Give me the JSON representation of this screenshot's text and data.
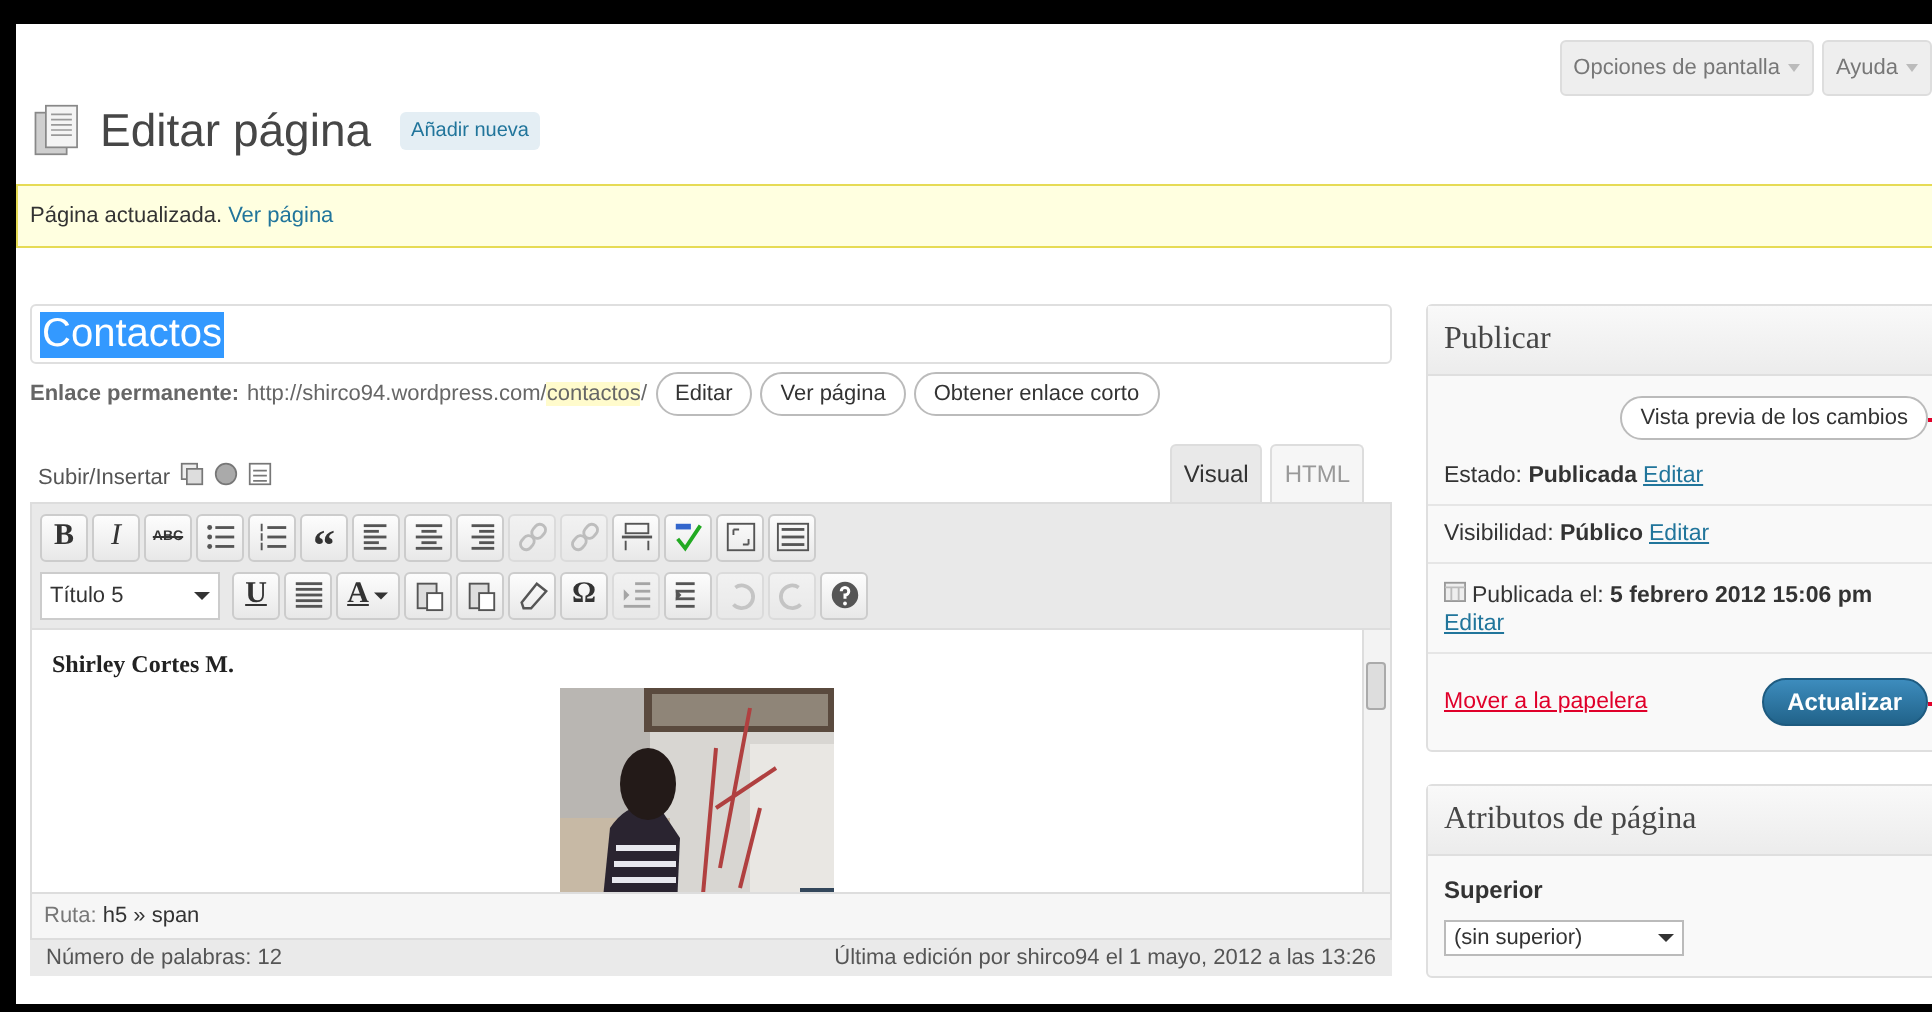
{
  "header": {
    "title": "Editar página",
    "add_new": "Añadir nueva",
    "screen_options": "Opciones de pantalla",
    "help": "Ayuda"
  },
  "notice": {
    "text": "Página actualizada.",
    "link": "Ver página"
  },
  "post_title": {
    "value": "Contactos"
  },
  "permalink": {
    "label": "Enlace permanente:",
    "url": "http://shirco94.wordpress.com/",
    "slug": "contactos",
    "suffix": "/",
    "buttons": [
      "Editar",
      "Ver página",
      "Obtener enlace corto"
    ]
  },
  "upload": {
    "label": "Subir/Insertar"
  },
  "editor_tabs": [
    {
      "label": "Visual",
      "selected": true
    },
    {
      "label": "HTML",
      "selected": false
    }
  ],
  "toolbar_row_1": [
    {
      "kind": "bold",
      "text": "B",
      "disabled": false
    },
    {
      "kind": "italic",
      "text": "I",
      "disabled": false
    },
    {
      "kind": "strike",
      "text": "ABC",
      "disabled": false
    },
    {
      "kind": "bullet-list",
      "disabled": false
    },
    {
      "kind": "number-list",
      "disabled": false
    },
    {
      "kind": "quote",
      "text": "“",
      "disabled": false
    },
    {
      "kind": "align-left",
      "disabled": false
    },
    {
      "kind": "align-center",
      "disabled": false
    },
    {
      "kind": "align-right",
      "disabled": false
    },
    {
      "kind": "link",
      "disabled": true
    },
    {
      "kind": "unlink",
      "disabled": true
    },
    {
      "kind": "more",
      "disabled": false
    },
    {
      "kind": "spellcheck",
      "disabled": false
    },
    {
      "kind": "fullscreen",
      "disabled": false
    },
    {
      "kind": "kitchen-sink",
      "disabled": false
    }
  ],
  "format_select": {
    "value": "Título 5"
  },
  "toolbar_row_2": [
    {
      "kind": "underline",
      "text": "U",
      "disabled": false
    },
    {
      "kind": "justify",
      "disabled": false
    },
    {
      "kind": "color",
      "text": "A",
      "disabled": false
    },
    {
      "kind": "paste-text",
      "disabled": false
    },
    {
      "kind": "paste-word",
      "disabled": false
    },
    {
      "kind": "eraser",
      "disabled": false
    },
    {
      "kind": "omega",
      "text": "Ω",
      "disabled": false
    },
    {
      "kind": "outdent",
      "disabled": true
    },
    {
      "kind": "indent",
      "disabled": false
    },
    {
      "kind": "undo",
      "disabled": true
    },
    {
      "kind": "redo",
      "disabled": true
    },
    {
      "kind": "help",
      "disabled": false
    }
  ],
  "content": {
    "heading": "Shirley  Cortes M."
  },
  "path": {
    "label": "Ruta:",
    "value": "h5 » span"
  },
  "status_bar": {
    "word_count": "Número de palabras: 12",
    "last_edit": "Última edición por shirco94 el 1 mayo, 2012 a las 13:26"
  },
  "publish": {
    "title": "Publicar",
    "preview": "Vista previa de los cambios",
    "rows": [
      {
        "kind": "status",
        "label": "Estado:",
        "value": "Publicada",
        "link": "Editar"
      },
      {
        "kind": "visibility",
        "label": "Visibilidad:",
        "value": "Público",
        "link": "Editar"
      },
      {
        "kind": "date",
        "label": "Publicada el:",
        "value": "5 febrero 2012 15:06 pm",
        "link": "Editar"
      }
    ],
    "trash": "Mover a la papelera",
    "update": "Actualizar"
  },
  "attributes": {
    "title": "Atributos de página",
    "parent_label": "Superior",
    "parent_value": "(sin superior)"
  }
}
